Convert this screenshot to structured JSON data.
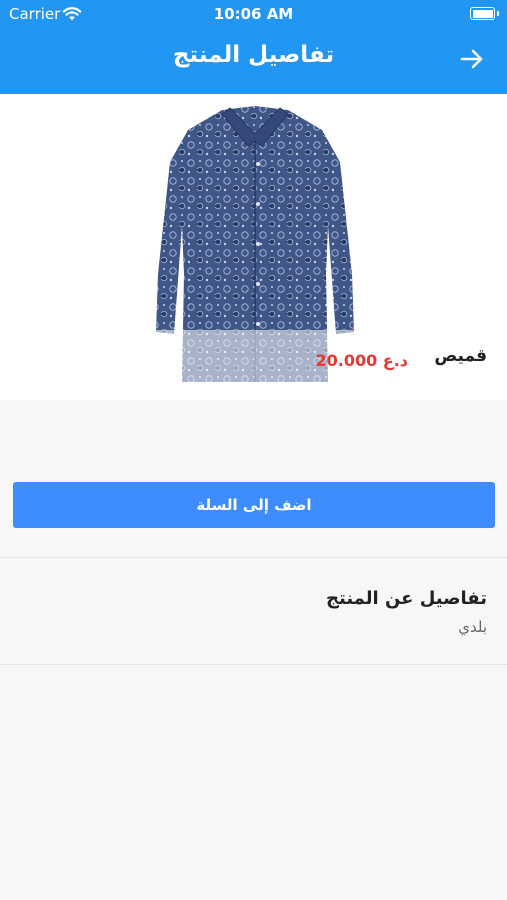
{
  "status_bar": {
    "carrier": "Carrier",
    "time": "10:06 AM"
  },
  "navbar": {
    "title": "تفاصيل المنتج",
    "back_icon": "arrow-right-icon"
  },
  "product": {
    "name": "قميص",
    "price": "20.000 د.ع",
    "image": "patterned-shirt-image"
  },
  "actions": {
    "add_to_cart": "اضف إلى السلة"
  },
  "details": {
    "title": "تفاصيل عن المنتج",
    "value": "بلدي"
  },
  "colors": {
    "primary": "#2196f3",
    "button": "#3f8cff",
    "price": "#e53935"
  }
}
